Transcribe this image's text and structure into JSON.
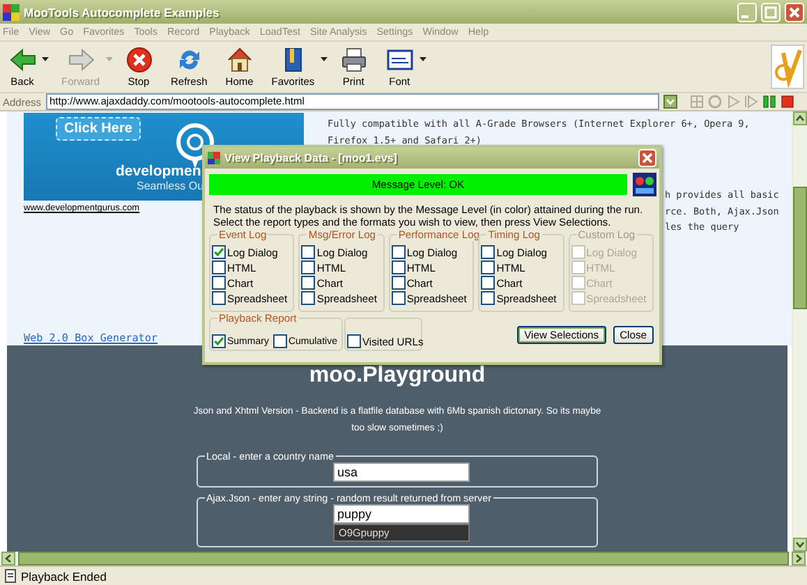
{
  "window": {
    "title": "MooTools Autocomplete Examples"
  },
  "menu": [
    "File",
    "View",
    "Go",
    "Favorites",
    "Tools",
    "Record",
    "Playback",
    "LoadTest",
    "Site Analysis",
    "Settings",
    "Window",
    "Help"
  ],
  "toolbar": [
    {
      "kind": "back",
      "label": "Back",
      "disabled": false,
      "dropdown": true
    },
    {
      "kind": "forward",
      "label": "Forward",
      "disabled": true,
      "dropdown": true
    },
    {
      "kind": "stop",
      "label": "Stop",
      "disabled": false,
      "dropdown": false
    },
    {
      "kind": "refresh",
      "label": "Refresh",
      "disabled": false,
      "dropdown": false
    },
    {
      "kind": "home",
      "label": "Home",
      "disabled": false,
      "dropdown": false
    },
    {
      "kind": "favorites",
      "label": "Favorites",
      "disabled": false,
      "dropdown": true
    },
    {
      "kind": "print",
      "label": "Print",
      "disabled": false,
      "dropdown": false
    },
    {
      "kind": "font",
      "label": "Font",
      "disabled": false,
      "dropdown": true
    }
  ],
  "address": {
    "label": "Address",
    "value": "http://www.ajaxdaddy.com/mootools-autocomplete.html"
  },
  "page": {
    "ad": {
      "button": "Click Here",
      "brand": "developmen",
      "tagline": "Seamless Ou",
      "link": "www.developmentgurus.com"
    },
    "intro": [
      "Fully compatible with all A-Grade Browsers (Internet Explorer 6+, Opera 9,",
      "Firefox 1.5+ and Safari 2+)"
    ],
    "partial_lines": [
      "h provides all basic",
      "rce. Both, Ajax.Json",
      "les the query"
    ],
    "link": "Web 2.0 Box Generator",
    "playground": {
      "title": "moo.Playground",
      "description": [
        "Json and Xhtml Version - Backend is a flatfile database with 6Mb spanish dictonary. So its maybe",
        "too slow sometimes ;)"
      ],
      "fields": [
        {
          "legend": "Local - enter a country name",
          "value": "usa"
        },
        {
          "legend": "Ajax.Json - enter any string - random result returned from server",
          "value": "puppy",
          "suggestions": [
            "O9Gpuppy"
          ]
        }
      ]
    }
  },
  "dialog": {
    "title": "View Playback Data - [moo1.evs]",
    "message": "Message Level: OK",
    "intro": [
      "The status of the playback is shown by the Message Level (in color) attained during the run.",
      "Select the report types and the formats you wish to view, then press View Selections."
    ],
    "groups": [
      {
        "title": "Event Log",
        "disabled": false,
        "options": [
          {
            "label": "Log Dialog",
            "checked": true
          },
          {
            "label": "HTML",
            "checked": false
          },
          {
            "label": "Chart",
            "checked": false
          },
          {
            "label": "Spreadsheet",
            "checked": false
          }
        ]
      },
      {
        "title": "Msg/Error Log",
        "disabled": false,
        "options": [
          {
            "label": "Log Dialog",
            "checked": false
          },
          {
            "label": "HTML",
            "checked": false
          },
          {
            "label": "Chart",
            "checked": false
          },
          {
            "label": "Spreadsheet",
            "checked": false
          }
        ]
      },
      {
        "title": "Performance Log",
        "disabled": false,
        "options": [
          {
            "label": "Log Dialog",
            "checked": false
          },
          {
            "label": "HTML",
            "checked": false
          },
          {
            "label": "Chart",
            "checked": false
          },
          {
            "label": "Spreadsheet",
            "checked": false
          }
        ]
      },
      {
        "title": "Timing Log",
        "disabled": false,
        "options": [
          {
            "label": "Log Dialog",
            "checked": false
          },
          {
            "label": "HTML",
            "checked": false
          },
          {
            "label": "Chart",
            "checked": false
          },
          {
            "label": "Spreadsheet",
            "checked": false
          }
        ]
      },
      {
        "title": "Custom Log",
        "disabled": true,
        "options": [
          {
            "label": "Log Dialog",
            "checked": false
          },
          {
            "label": "HTML",
            "checked": false
          },
          {
            "label": "Chart",
            "checked": false
          },
          {
            "label": "Spreadsheet",
            "checked": false
          }
        ]
      }
    ],
    "playback_report": {
      "title": "Playback Report",
      "options": [
        {
          "label": "Summary",
          "checked": true
        },
        {
          "label": "Cumulative",
          "checked": false
        }
      ]
    },
    "extra_option": {
      "label": "Visited URLs",
      "checked": false
    },
    "buttons": [
      {
        "label": "View Selections",
        "default": true
      },
      {
        "label": "Close",
        "default": false
      }
    ]
  },
  "status_bar": "Playback Ended"
}
